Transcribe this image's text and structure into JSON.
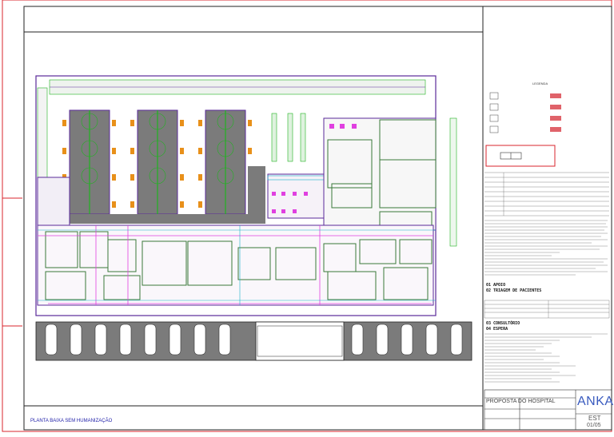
{
  "drawing": {
    "caption": "PLANTA BAIXA SEM HUMANIZAÇÃO"
  },
  "title_block": {
    "project": "PROPOSTA DO HOSPITAL",
    "brand": "ANKA",
    "brand_sub": "EST",
    "sheet_code": "01/05"
  },
  "notes": {
    "legend_title": "LEGENDA",
    "handwritten": [
      "01 APOIO",
      "02 TRIAGEM DE PACIENTES",
      "03 CONSULTÓRIO",
      "04 ESPERA"
    ]
  },
  "colors": {
    "frame_red": "#d8242c",
    "wall_purple": "#5a2a9a",
    "green": "#1fb31f",
    "cyan": "#16b3c8",
    "magenta": "#e040e0",
    "orange": "#e8901a",
    "parking_gray": "#7b7b7b",
    "text_blue": "#2222aa"
  }
}
